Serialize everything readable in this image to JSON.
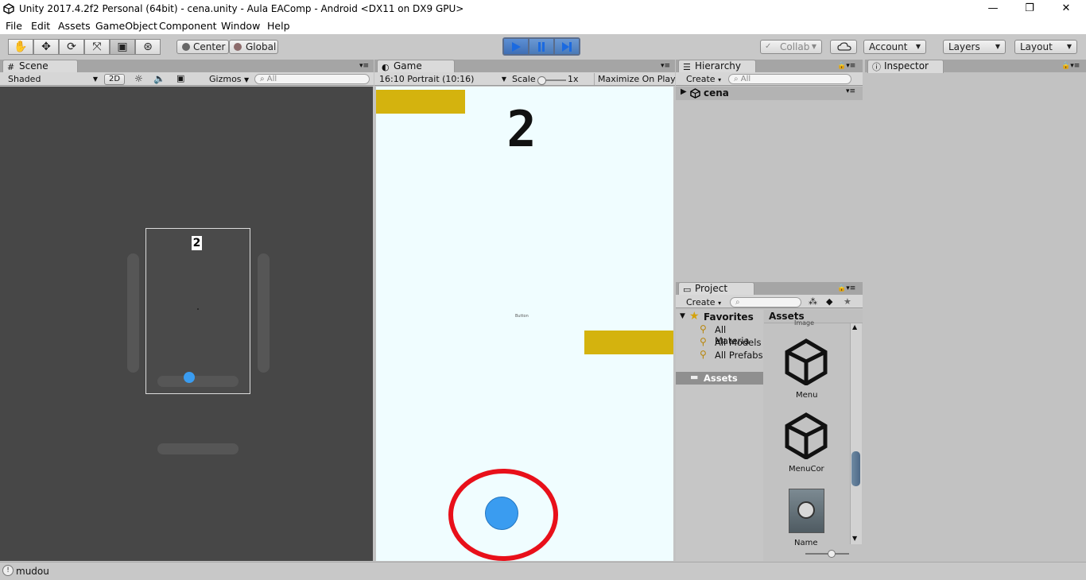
{
  "window": {
    "title": "Unity 2017.4.2f2 Personal (64bit) - cena.unity - Aula EAComp - Android <DX11 on DX9 GPU>",
    "minimize": "—",
    "maximize": "❐",
    "close": "✕"
  },
  "menu": [
    "File",
    "Edit",
    "Assets",
    "GameObject",
    "Component",
    "Window",
    "Help"
  ],
  "toolbar": {
    "tools": [
      "hand-icon",
      "move-icon",
      "rotate-icon",
      "scale-icon",
      "rect-icon",
      "transform-icon"
    ],
    "pivot": "Center",
    "space": "Global",
    "collab": "Collab",
    "account": "Account",
    "layers": "Layers",
    "layout": "Layout"
  },
  "scene": {
    "tab": "Scene",
    "shading": "Shaded",
    "mode_2d": "2D",
    "gizmos": "Gizmos",
    "search_placeholder": "All",
    "score": "2"
  },
  "game": {
    "tab": "Game",
    "aspect": "16:10 Portrait (10:16)",
    "scale_label": "Scale",
    "scale_value": "1x",
    "maximize": "Maximize On Play",
    "score": "2",
    "button_label": "Button"
  },
  "hierarchy": {
    "tab": "Hierarchy",
    "create": "Create",
    "search_placeholder": "All",
    "scene_name": "cena"
  },
  "project": {
    "tab": "Project",
    "create": "Create",
    "favorites": "Favorites",
    "favorite_items": [
      "All Materia",
      "All Models",
      "All Prefabs"
    ],
    "assets_folder": "Assets",
    "assets_header": "Assets",
    "asset_items": [
      "Menu",
      "MenuCor",
      "Name"
    ],
    "partial_label": "Image"
  },
  "inspector": {
    "tab": "Inspector"
  },
  "status": {
    "message": "mudou"
  },
  "colors": {
    "accent_play": "#3f7fd6",
    "paddle": "#d4b30e",
    "ball": "#3a9cf0",
    "highlight_circle": "#e8101a",
    "game_bg": "#f0fdff",
    "scene_bg": "#474747"
  }
}
